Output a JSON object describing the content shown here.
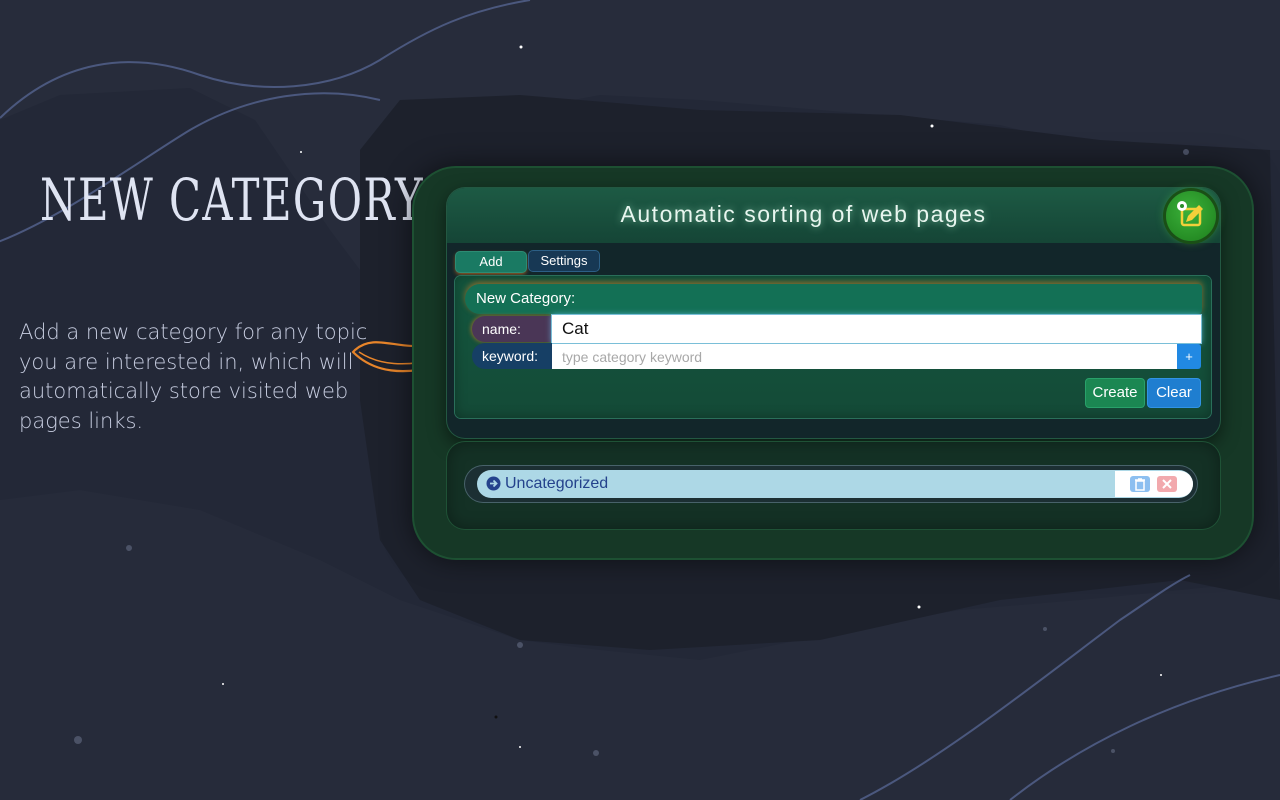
{
  "promo": {
    "title": "NEW CATEGORY",
    "description": "Add a new category for any topic you are interested in, which will automatically store visited web pages links."
  },
  "app": {
    "title": "Automatic sorting of web pages",
    "tabs": [
      {
        "label": "Add",
        "active": true
      },
      {
        "label": "Settings",
        "active": false
      }
    ],
    "form": {
      "heading": "New Category:",
      "name_label": "name:",
      "name_value": "Cat",
      "keyword_label": "keyword:",
      "keyword_placeholder": "type category keyword",
      "add_keyword_label": "+",
      "create_label": "Create",
      "clear_label": "Clear"
    },
    "categories": [
      {
        "label": "Uncategorized"
      }
    ]
  },
  "icons": {
    "settings": "settings-edit-icon",
    "category": "arrow-circle-right-icon",
    "delete": "trash-icon",
    "remove": "close-icon"
  },
  "colors": {
    "background": "#232837",
    "frame": "#163826",
    "accent_orange": "#e87d22",
    "create": "#1b8752",
    "clear": "#1f7ed0"
  }
}
